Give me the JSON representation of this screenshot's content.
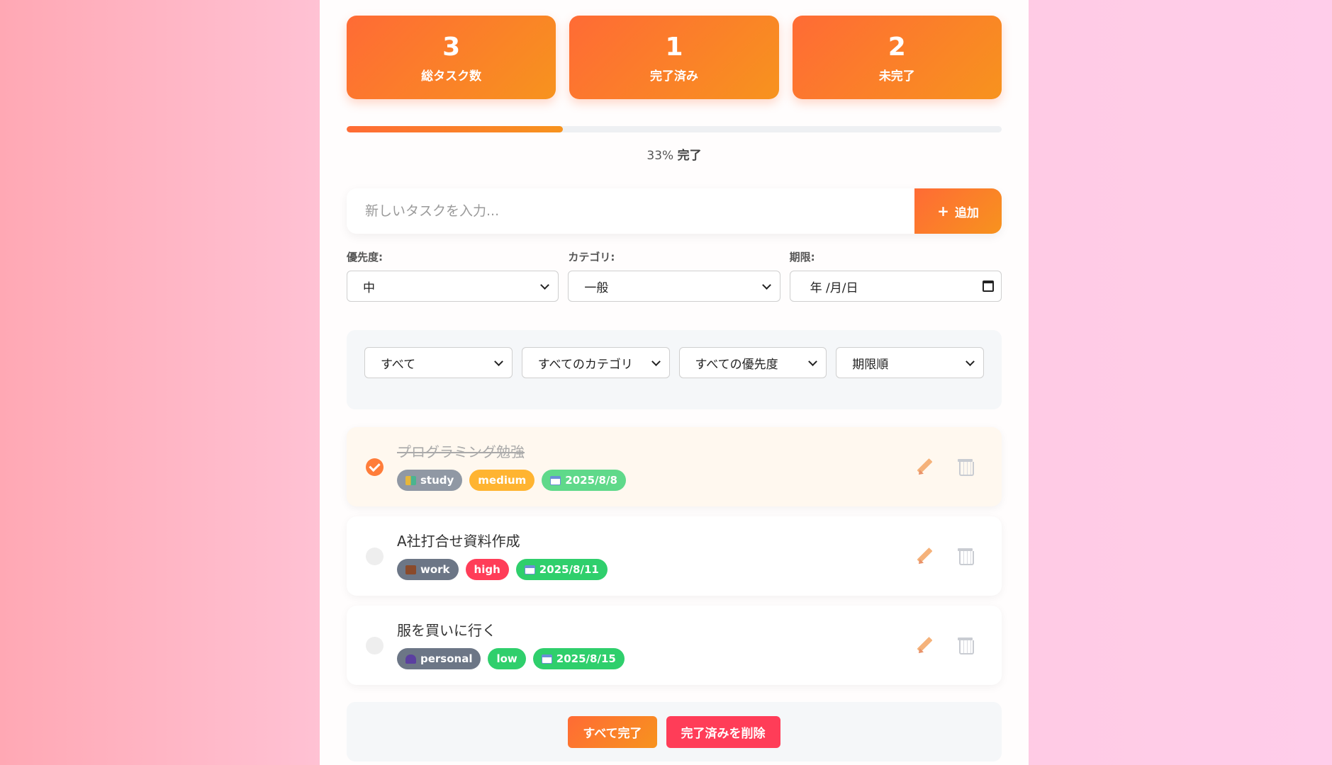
{
  "stats": [
    {
      "value": "3",
      "label": "総タスク数"
    },
    {
      "value": "1",
      "label": "完了済み"
    },
    {
      "value": "2",
      "label": "未完了"
    }
  ],
  "progress": {
    "percent": 33,
    "pct_label": "33%",
    "suffix": "完了"
  },
  "add": {
    "placeholder": "新しいタスクを入力...",
    "button_label": "追加",
    "button_icon": "plus-icon"
  },
  "options": {
    "priority": {
      "label": "優先度:",
      "value": "中"
    },
    "category": {
      "label": "カテゴリ:",
      "value": "一般"
    },
    "due": {
      "label": "期限:",
      "value": "年 /月/日",
      "icon": "calendar-icon"
    }
  },
  "filters": {
    "status": "すべて",
    "category": "すべてのカテゴリ",
    "priority": "すべての優先度",
    "sort": "期限順"
  },
  "tasks": [
    {
      "title": "プログラミング勉強",
      "done": true,
      "category": "study",
      "category_icon": "books-icon",
      "priority": "medium",
      "due": "2025/8/8"
    },
    {
      "title": "A社打合せ資料作成",
      "done": false,
      "category": "work",
      "category_icon": "briefcase-icon",
      "priority": "high",
      "due": "2025/8/11"
    },
    {
      "title": "服を買いに行く",
      "done": false,
      "category": "personal",
      "category_icon": "person-icon",
      "priority": "low",
      "due": "2025/8/15"
    }
  ],
  "bulk": {
    "complete_all": "すべて完了",
    "delete_completed": "完了済みを削除"
  },
  "colors": {
    "accent_start": "#ff6b35",
    "accent_end": "#f7931e",
    "danger": "#ff3d58",
    "success": "#2fcf6c",
    "warning": "#ffb431"
  }
}
